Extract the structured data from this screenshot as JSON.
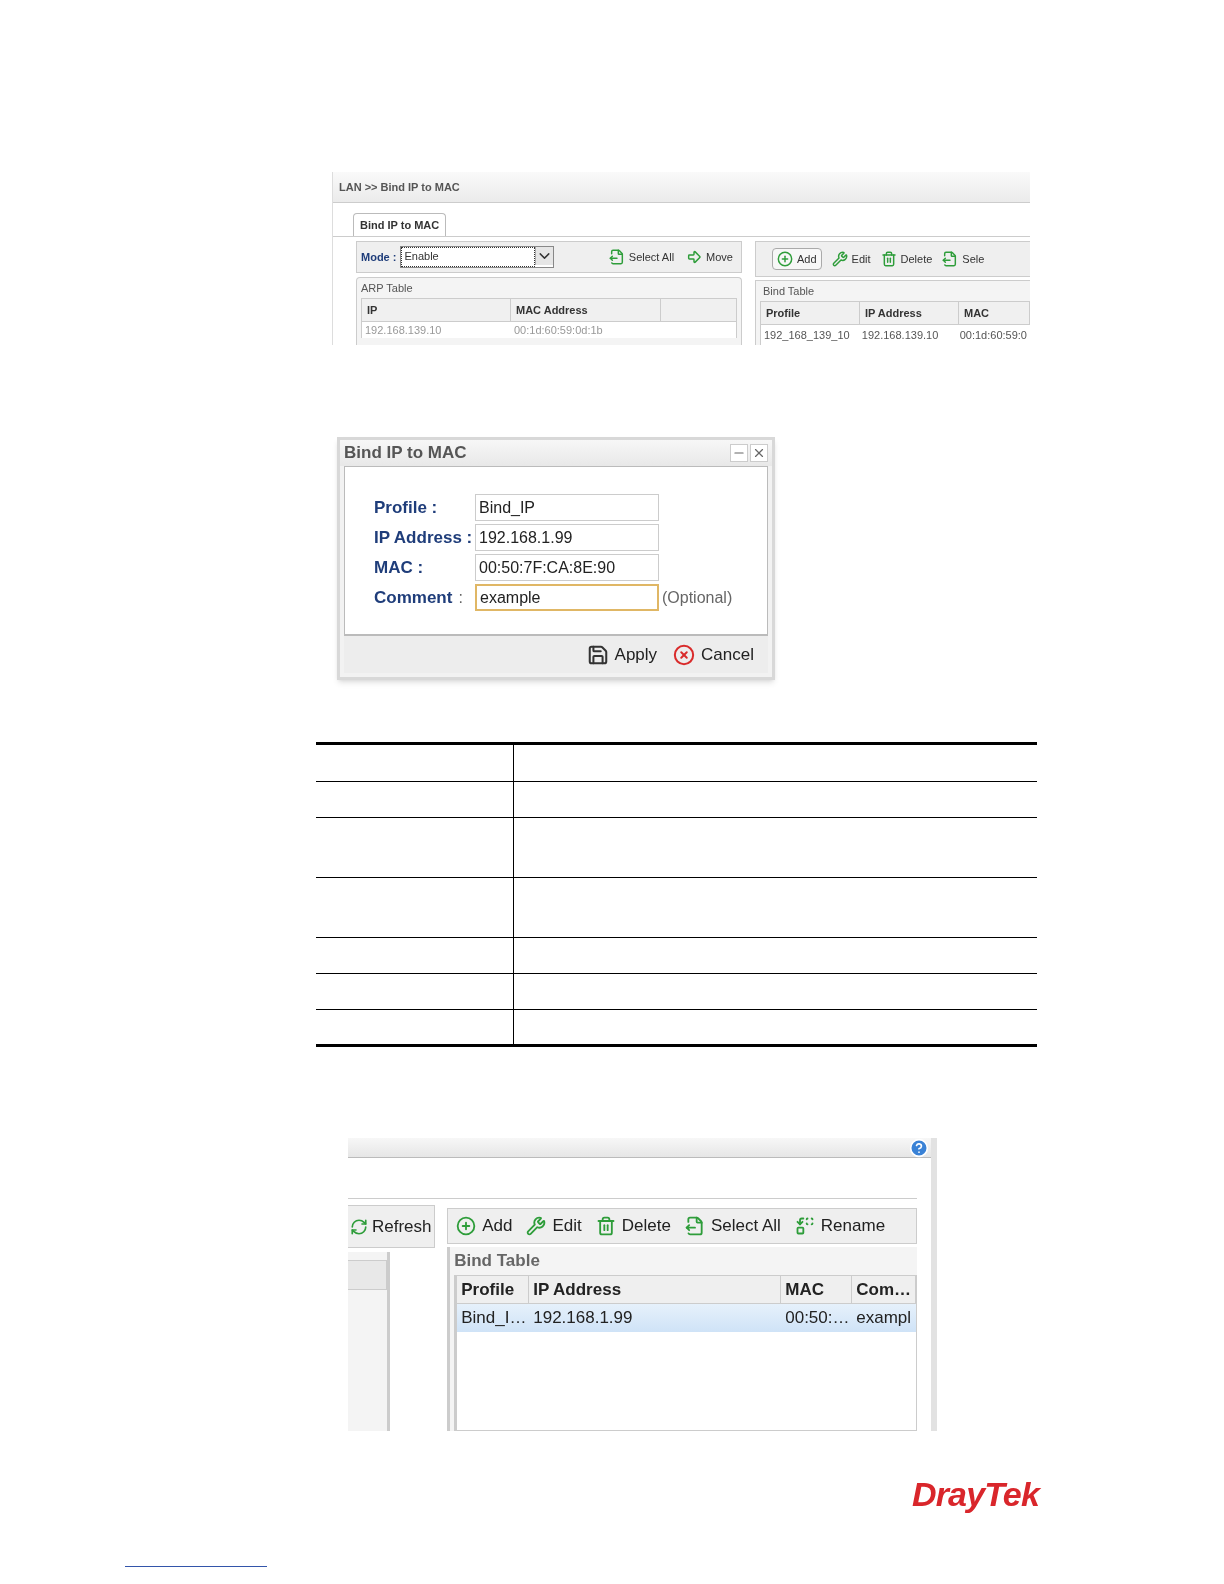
{
  "screen1": {
    "breadcrumb": "LAN >> Bind IP to MAC",
    "tabs": [
      {
        "label": "Bind IP to MAC",
        "selected": true
      }
    ],
    "mode": {
      "label": "Mode :",
      "value": "Enable"
    },
    "left_toolbar": [
      {
        "kind": "select_all",
        "label": "Select All"
      },
      {
        "kind": "move",
        "label": "Move"
      }
    ],
    "arp_table": {
      "title": "ARP Table",
      "columns": [
        "IP",
        "MAC Address"
      ],
      "rows": [
        [
          "192.168.139.10",
          "00:1d:60:59:0d:1b"
        ]
      ]
    },
    "right_toolbar": [
      {
        "kind": "add",
        "label": "Add"
      },
      {
        "kind": "edit",
        "label": "Edit"
      },
      {
        "kind": "delete",
        "label": "Delete"
      },
      {
        "kind": "select_all",
        "label": "Sele"
      }
    ],
    "bind_table": {
      "title": "Bind Table",
      "columns": [
        "Profile",
        "IP Address",
        "MAC"
      ],
      "rows": [
        [
          "192_168_139_10",
          "192.168.139.10",
          "00:1d:60:59:0"
        ]
      ]
    }
  },
  "dialog": {
    "title": "Bind IP to MAC",
    "fields": [
      {
        "label": "Profile :",
        "value": "Bind_IP",
        "focused": false
      },
      {
        "label": "IP Address :",
        "value": "192.168.1.99",
        "focused": false
      },
      {
        "label": "MAC :",
        "value": "00:50:7F:CA:8E:90",
        "focused": false
      },
      {
        "label": "Comment",
        "separator": ":",
        "value": "example",
        "focused": true,
        "hint": "(Optional)"
      }
    ],
    "buttons": [
      {
        "kind": "apply",
        "label": "Apply"
      },
      {
        "kind": "cancel",
        "label": "Cancel"
      }
    ]
  },
  "screen3": {
    "left_toolbar": [
      {
        "kind": "refresh",
        "label": "Refresh"
      }
    ],
    "toolbar": [
      {
        "kind": "add",
        "label": "Add"
      },
      {
        "kind": "edit",
        "label": "Edit"
      },
      {
        "kind": "delete",
        "label": "Delete"
      },
      {
        "kind": "select_all",
        "label": "Select All"
      },
      {
        "kind": "rename",
        "label": "Rename"
      }
    ],
    "bind_table": {
      "title": "Bind Table",
      "columns": [
        "Profile",
        "IP Address",
        "MAC",
        "Com…"
      ],
      "rows": [
        {
          "cells": [
            "Bind_I…",
            "192.168.1.99",
            "00:50:…",
            "exampl"
          ],
          "selected": true
        }
      ]
    }
  },
  "logo": "DrayTek"
}
